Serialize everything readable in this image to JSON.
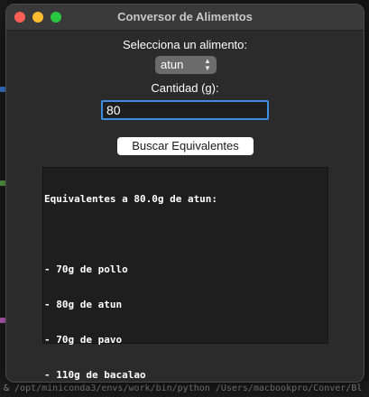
{
  "window": {
    "title": "Conversor de Alimentos"
  },
  "form": {
    "select_label": "Selecciona un alimento:",
    "selected_food": "atun",
    "quantity_label": "Cantidad (g):",
    "quantity_value": "80",
    "search_button": "Buscar Equivalentes"
  },
  "results": {
    "lines": [
      "Equivalentes a 80.0g de atun:",
      "",
      "- 70g de pollo",
      "- 80g de atun",
      "- 70g de pavo",
      "- 110g de bacalao"
    ]
  },
  "background": {
    "terminal_bottom_text": "& /opt/miniconda3/envs/work/bin/python /Users/macbookpro/Conver/Bl"
  },
  "colors": {
    "accent_focus": "#3b8ee0",
    "close": "#ff5f57",
    "minimize": "#febc2e",
    "maximize": "#28c840"
  }
}
